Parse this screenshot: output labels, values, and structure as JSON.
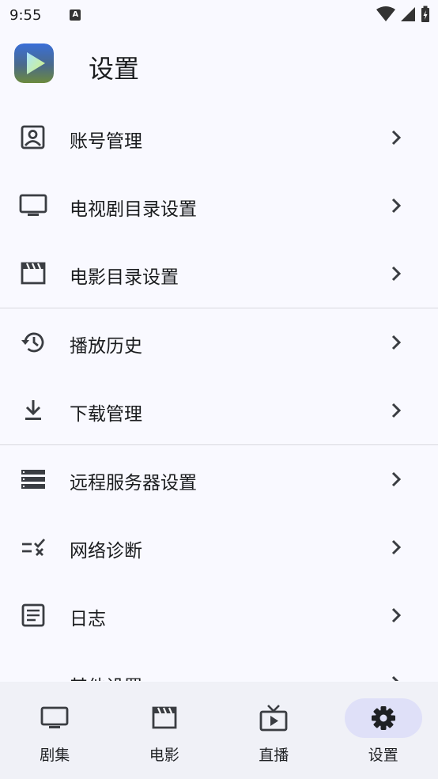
{
  "status_bar": {
    "time": "9:55",
    "notification_letter": "A",
    "icons": [
      "wifi-icon",
      "signal-icon",
      "battery-charging-icon"
    ]
  },
  "header": {
    "logo": "play-logo-icon",
    "title": "设置"
  },
  "menu": {
    "groups": [
      [
        {
          "label": "账号管理",
          "icon": "account-box-icon"
        },
        {
          "label": "电视剧目录设置",
          "icon": "tv-icon"
        },
        {
          "label": "电影目录设置",
          "icon": "movie-icon"
        }
      ],
      [
        {
          "label": "播放历史",
          "icon": "history-icon"
        },
        {
          "label": "下载管理",
          "icon": "download-icon"
        }
      ],
      [
        {
          "label": "远程服务器设置",
          "icon": "storage-icon"
        },
        {
          "label": "网络诊断",
          "icon": "rule-icon"
        },
        {
          "label": "日志",
          "icon": "article-icon"
        },
        {
          "label": "其他设置",
          "icon": "more-icon"
        }
      ]
    ]
  },
  "bottom_nav": {
    "items": [
      {
        "label": "剧集",
        "icon": "tv-icon",
        "active": false
      },
      {
        "label": "电影",
        "icon": "movie-icon",
        "active": false
      },
      {
        "label": "直播",
        "icon": "live-tv-icon",
        "active": false
      },
      {
        "label": "设置",
        "icon": "gear-icon",
        "active": true
      }
    ]
  },
  "colors": {
    "background": "#f9f9ff",
    "nav_background": "#f0f1f7",
    "active_pill": "#dfe0f8",
    "icon": "#3a3d42"
  }
}
